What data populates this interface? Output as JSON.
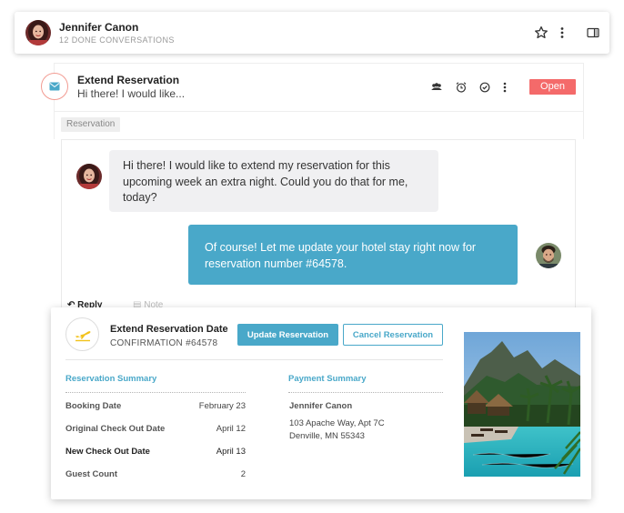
{
  "contact": {
    "name": "Jennifer Canon",
    "subtitle": "12 DONE CONVERSATIONS",
    "icons": [
      "star-icon",
      "more-vertical-icon",
      "side-panel-icon"
    ]
  },
  "conversation": {
    "title": "Extend Reservation",
    "preview": "Hi there! I would like...",
    "status": "Open",
    "tag": "Reservation",
    "icons": [
      "assign-users-icon",
      "alarm-clock-icon",
      "check-circle-icon",
      "more-vertical-icon"
    ]
  },
  "messages": [
    {
      "from": "customer",
      "text": "Hi there! I would like to extend my reservation for this upcoming week an extra night. Could you do that for me, today?"
    },
    {
      "from": "agent",
      "text": "Of course! Let me update your hotel stay right now for reservation number #64578."
    }
  ],
  "composer": {
    "reply_label": "Reply",
    "note_label": "Note"
  },
  "reservation": {
    "title": "Extend Reservation Date",
    "confirmation": "CONFIRMATION #64578",
    "update_button": "Update Reservation",
    "cancel_button": "Cancel Reservation",
    "summary_heading": "Reservation Summary",
    "rows": [
      {
        "label": "Booking Date",
        "value": "February  23"
      },
      {
        "label": "Original Check Out Date",
        "value": "April 12"
      },
      {
        "label": "New Check Out Date",
        "value": "April 13"
      },
      {
        "label": "Guest Count",
        "value": "2"
      }
    ],
    "payment_heading": "Payment Summary",
    "payment_name": "Jennifer Canon",
    "payment_address": [
      "103 Apache Way, Apt 7C",
      "Denville, MN 55343"
    ]
  },
  "colors": {
    "accent": "#49a8c9",
    "status_open": "#f46a6a",
    "mail_ring": "#f29b92",
    "plane": "#f2c21b"
  }
}
